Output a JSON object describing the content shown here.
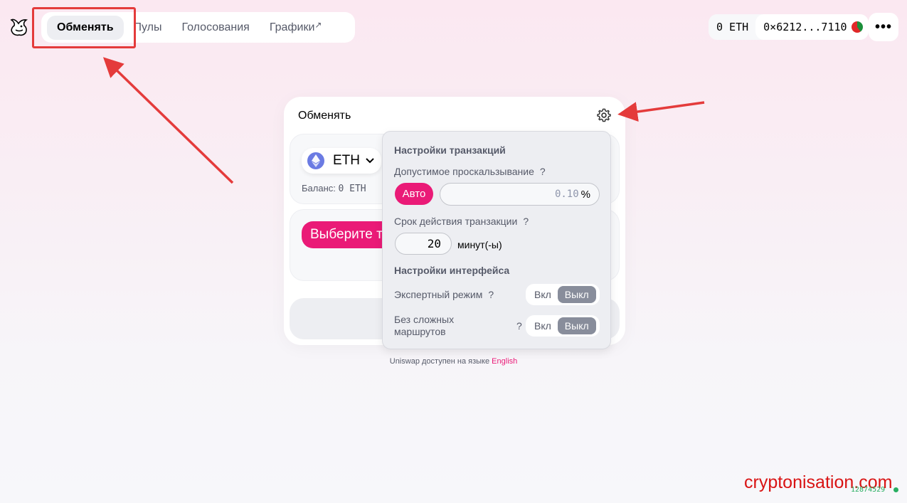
{
  "header": {
    "nav": [
      {
        "label": "Обменять",
        "active": true
      },
      {
        "label": "Пулы",
        "active": false
      },
      {
        "label": "Голосования",
        "active": false
      },
      {
        "label": "Графики",
        "active": false,
        "external_icon": "↗"
      }
    ],
    "wallet": {
      "balance": "0 ETH",
      "address": "0×6212...7110"
    },
    "more_label": "•••"
  },
  "swap": {
    "title": "Обменять",
    "input_token": "ETH",
    "balance_label": "Баланс:",
    "balance_value": "0 ETH",
    "select_token_label": "Выберите токен"
  },
  "settings": {
    "transaction_title": "Настройки транзакций",
    "slippage_label": "Допустимое проскальзывание",
    "auto_label": "Авто",
    "slippage_placeholder": "0.10",
    "percent": "%",
    "deadline_label": "Срок действия транзакции",
    "deadline_value": "20",
    "minutes_label": "минут(-ы)",
    "interface_title": "Настройки интерфейса",
    "expert_label": "Экспертный режим",
    "multihop_label": "Без сложных маршрутов",
    "on_label": "Вкл",
    "off_label": "Выкл",
    "help": "?"
  },
  "footer": {
    "note": "Uniswap доступен на языке",
    "link": "English"
  },
  "watermark": "cryptonisation.com",
  "block_number": "12874529",
  "colors": {
    "accent": "#ea1a77",
    "annotation": "#e43b3b",
    "status": "#27ae60"
  }
}
